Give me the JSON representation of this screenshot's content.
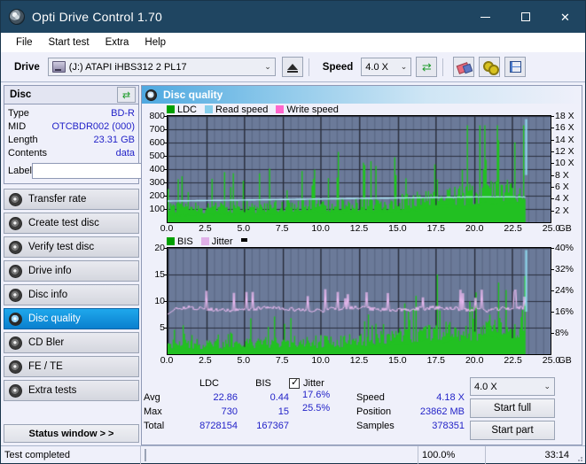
{
  "window": {
    "title": "Opti Drive Control 1.70",
    "icon": "disc-icon"
  },
  "window_buttons": {
    "minimize": "−",
    "maximize": "□",
    "close": "✕"
  },
  "menu": {
    "items": [
      "File",
      "Start test",
      "Extra",
      "Help"
    ]
  },
  "toolbar": {
    "drive_label": "Drive",
    "drive_value": "(J:)  ATAPI iHBS312  2 PL17",
    "eject_title": "eject-button",
    "speed_label": "Speed",
    "speed_value": "4.0 X",
    "refresh_title": "refresh-button",
    "erase_title": "erase-button",
    "settings_title": "settings-button",
    "save_title": "save-button"
  },
  "disc_panel": {
    "title": "Disc",
    "refresh_icon": "refresh-icon",
    "rows": [
      {
        "key": "Type",
        "value": "BD-R"
      },
      {
        "key": "MID",
        "value": "OTCBDR002 (000)"
      },
      {
        "key": "Length",
        "value": "23.31 GB"
      },
      {
        "key": "Contents",
        "value": "data"
      }
    ],
    "label_key": "Label",
    "label_value": "",
    "label_placeholder": ""
  },
  "nav": {
    "items": [
      {
        "label": "Transfer rate",
        "active": false
      },
      {
        "label": "Create test disc",
        "active": false
      },
      {
        "label": "Verify test disc",
        "active": false
      },
      {
        "label": "Drive info",
        "active": false
      },
      {
        "label": "Disc info",
        "active": false
      },
      {
        "label": "Disc quality",
        "active": true
      },
      {
        "label": "CD Bler",
        "active": false
      },
      {
        "label": "FE / TE",
        "active": false
      },
      {
        "label": "Extra tests",
        "active": false
      }
    ],
    "status_window_button": "Status window > >"
  },
  "main": {
    "header_title": "Disc quality",
    "header_icon": "disc-quality-icon"
  },
  "chart_data": [
    {
      "type": "line",
      "id": "ldc-chart",
      "title": "LDC / Read speed / Write speed",
      "xlabel": "GB",
      "ylabel": "LDC",
      "xlim": [
        0,
        25
      ],
      "xticks": [
        "0.0",
        "2.5",
        "5.0",
        "7.5",
        "10.0",
        "12.5",
        "15.0",
        "17.5",
        "20.0",
        "22.5",
        "25.0"
      ],
      "xunit": "GB",
      "ylim": [
        0,
        800
      ],
      "yticks": [
        "800",
        "700",
        "600",
        "500",
        "400",
        "300",
        "200",
        "100"
      ],
      "y2label": "Speed",
      "y2lim": [
        0,
        18
      ],
      "y2ticks": [
        "18 X",
        "16 X",
        "14 X",
        "12 X",
        "10 X",
        "8 X",
        "6 X",
        "4 X",
        "2 X"
      ],
      "grid": true,
      "legend": [
        {
          "name": "LDC",
          "color": "#00a000"
        },
        {
          "name": "Read speed",
          "color": "#87ceeb"
        },
        {
          "name": "Write speed",
          "color": "#ff66cc"
        }
      ],
      "series": [
        {
          "name": "LDC",
          "color": "#22c022",
          "avg": 22.86,
          "max": 730,
          "total": 8728154,
          "data_end_x": 23.4
        },
        {
          "name": "Read speed",
          "color": "#aee6f7",
          "start": 3.6,
          "end": 4.3,
          "avg": 4.18
        }
      ],
      "data_end_marker_x": 23.4
    },
    {
      "type": "line",
      "id": "bis-jitter-chart",
      "title": "BIS / Jitter",
      "xlabel": "GB",
      "ylabel": "BIS",
      "xlim": [
        0,
        25
      ],
      "xticks": [
        "0.0",
        "2.5",
        "5.0",
        "7.5",
        "10.0",
        "12.5",
        "15.0",
        "17.5",
        "20.0",
        "22.5",
        "25.0"
      ],
      "xunit": "GB",
      "ylim": [
        0,
        20
      ],
      "yticks": [
        "20",
        "15",
        "10",
        "5"
      ],
      "y2label": "Jitter",
      "y2lim": [
        0,
        40
      ],
      "y2ticks": [
        "40%",
        "32%",
        "24%",
        "16%",
        "8%"
      ],
      "grid": true,
      "legend": [
        {
          "name": "BIS",
          "color": "#00a000"
        },
        {
          "name": "Jitter",
          "color": "#e0b0e8"
        },
        {
          "name": "marker",
          "color": "#000000"
        }
      ],
      "series": [
        {
          "name": "BIS",
          "color": "#22c022",
          "avg": 0.44,
          "max": 15,
          "total": 167367,
          "data_end_x": 23.4
        },
        {
          "name": "Jitter",
          "color": "#e7b8ee",
          "avg_pct": 17.6,
          "max_pct": 25.5
        }
      ],
      "data_end_marker_x": 23.4
    }
  ],
  "stats": {
    "headers": {
      "ldc": "LDC",
      "bis": "BIS"
    },
    "rows": [
      {
        "label": "Avg",
        "ldc": "22.86",
        "bis": "0.44"
      },
      {
        "label": "Max",
        "ldc": "730",
        "bis": "15"
      },
      {
        "label": "Total",
        "ldc": "8728154",
        "bis": "167367"
      }
    ],
    "jitter": {
      "checkbox_checked": true,
      "label": "Jitter",
      "avg": "17.6%",
      "max": "25.5%"
    },
    "speed_rows": [
      {
        "label": "Speed",
        "value": "4.18 X"
      },
      {
        "label": "Position",
        "value": "23862 MB"
      },
      {
        "label": "Samples",
        "value": "378351"
      }
    ],
    "speed_select": "4.0 X",
    "start_full_button": "Start full",
    "start_part_button": "Start part"
  },
  "statusbar": {
    "message": "Test completed",
    "progress_percent": "100.0%",
    "progress_value": 100,
    "elapsed": "33:14"
  },
  "colors": {
    "titlebar": "#1f4561",
    "accent": "#0a7fce",
    "value_text": "#2323c8",
    "plot_bg": "#6b7a99",
    "ldc_green": "#22c022",
    "jitter_pink": "#e7b8ee",
    "read_speed_blue": "#aee6f7",
    "progress_green": "#12b312"
  }
}
